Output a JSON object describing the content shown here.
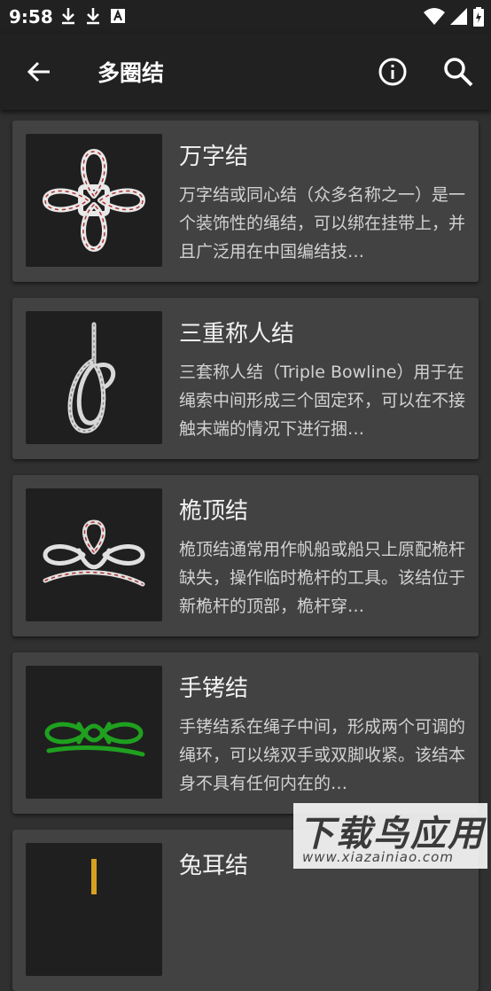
{
  "status_bar": {
    "time": "9:58",
    "left_icons": [
      "download-icon",
      "download-icon",
      "text-app-icon"
    ],
    "right_icons": [
      "wifi-icon",
      "signal-icon",
      "battery-icon"
    ]
  },
  "app_bar": {
    "title": "多圈结",
    "back_icon": "arrow-back-icon",
    "info_icon": "info-icon",
    "search_icon": "search-icon"
  },
  "knots": [
    {
      "title": "万字结",
      "description": "万字结或同心结（众多名称之一）是一个装饰性的绳结，可以绑在挂带上，并且广泛用在中国编结技…"
    },
    {
      "title": "三重称人结",
      "description": "三套称人结（Triple Bowline）用于在绳索中间形成三个固定环，可以在不接触末端的情况下进行捆…"
    },
    {
      "title": "桅顶结",
      "description": "桅顶结通常用作帆船或船只上原配桅杆缺失，操作临时桅杆的工具。该结位于新桅杆的顶部，桅杆穿…"
    },
    {
      "title": "手铐结",
      "description": "手铐结系在绳子中间，形成两个可调的绳环，可以绕双手或双脚收紧。该结本身不具有任何内在的…"
    },
    {
      "title": "兔耳结",
      "description": ""
    }
  ],
  "watermark": {
    "main": "下载鸟应用",
    "url": "www.xiazainiao.com"
  },
  "colors": {
    "background": "#303030",
    "card": "#424242",
    "app_bar": "#212121",
    "rope_white": "#e8e8e8",
    "rope_red": "#b03030",
    "rope_green": "#1fa01f"
  }
}
